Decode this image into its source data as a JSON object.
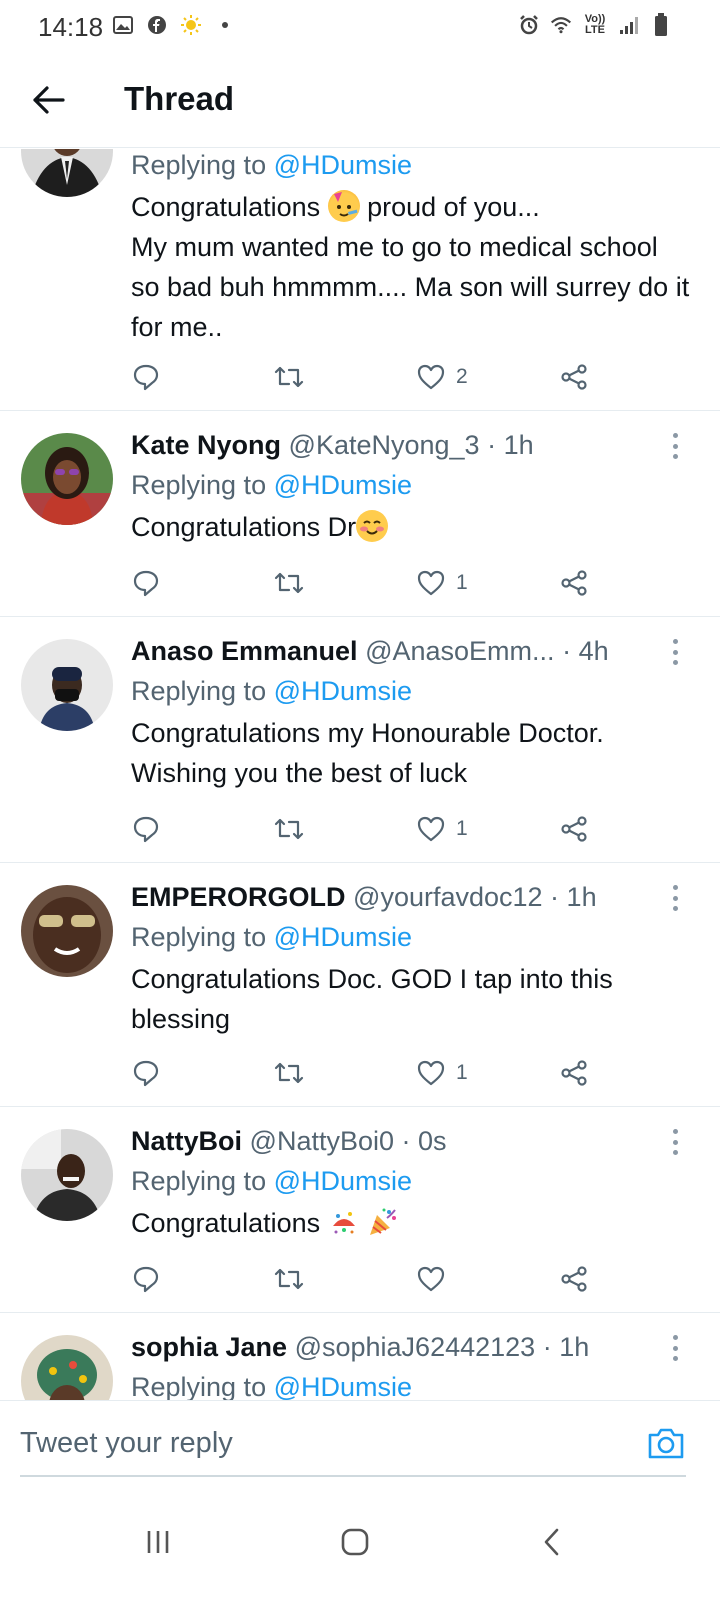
{
  "status_bar": {
    "time": "14:18",
    "left_icons": [
      "gallery-icon",
      "facebook-icon",
      "sun-icon",
      "dot-icon"
    ],
    "right_icons": [
      "alarm-icon",
      "wifi-icon",
      "volte-icon",
      "signal-icon",
      "battery-icon"
    ],
    "volte_top": "Vo))",
    "volte_bottom": "LTE"
  },
  "header": {
    "title": "Thread",
    "back_icon": "arrow-left-icon"
  },
  "tweets": [
    {
      "name": "",
      "handle": "",
      "time": "",
      "replying_prefix": "Replying to ",
      "replying_handle": "@HDumsie",
      "text_before_emoji": "Congratulations ",
      "emoji": "partying-face-emoji",
      "text_after_emoji": " proud of you...",
      "text_more": "My mum wanted me to go to medical school so bad buh hmmmm.... Ma son will surrey do it for me..",
      "likes": "2"
    },
    {
      "name": "Kate Nyong",
      "handle": "@KateNyong_3",
      "time": "1h",
      "replying_prefix": "Replying to ",
      "replying_handle": "@HDumsie",
      "text": "Congratulations Dr",
      "emoji": "smiling-face-emoji",
      "likes": "1"
    },
    {
      "name": "Anaso Emmanuel",
      "handle": "@AnasoEmm...",
      "time": "4h",
      "replying_prefix": "Replying to ",
      "replying_handle": "@HDumsie",
      "text": "Congratulations my Honourable Doctor. Wishing you the best of luck",
      "likes": "1"
    },
    {
      "name": "EMPERORGOLD",
      "handle": "@yourfavdoc12",
      "time": "1h",
      "replying_prefix": "Replying to ",
      "replying_handle": "@HDumsie",
      "text": "Congratulations Doc. GOD I tap into this blessing",
      "likes": "1"
    },
    {
      "name": "NattyBoi",
      "handle": "@NattyBoi0",
      "time": "0s",
      "replying_prefix": "Replying to ",
      "replying_handle": "@HDumsie",
      "text": "Congratulations ",
      "emojis": [
        "confetti-ball-emoji",
        "party-popper-emoji"
      ],
      "likes": ""
    },
    {
      "name": "sophia Jane",
      "handle": "@sophiaJ62442123",
      "time": "1h",
      "replying_prefix": "Replying to ",
      "replying_handle": "@HDumsie"
    }
  ],
  "separator": " · ",
  "composer": {
    "placeholder": "Tweet your reply",
    "camera_icon": "camera-icon"
  },
  "navbar": {
    "icons": [
      "recent-apps-icon",
      "home-icon",
      "back-icon"
    ]
  },
  "colors": {
    "link_blue": "#1d9bf0",
    "text_primary": "#0f1419",
    "text_secondary": "#536471",
    "divider": "#e6ecf0"
  }
}
